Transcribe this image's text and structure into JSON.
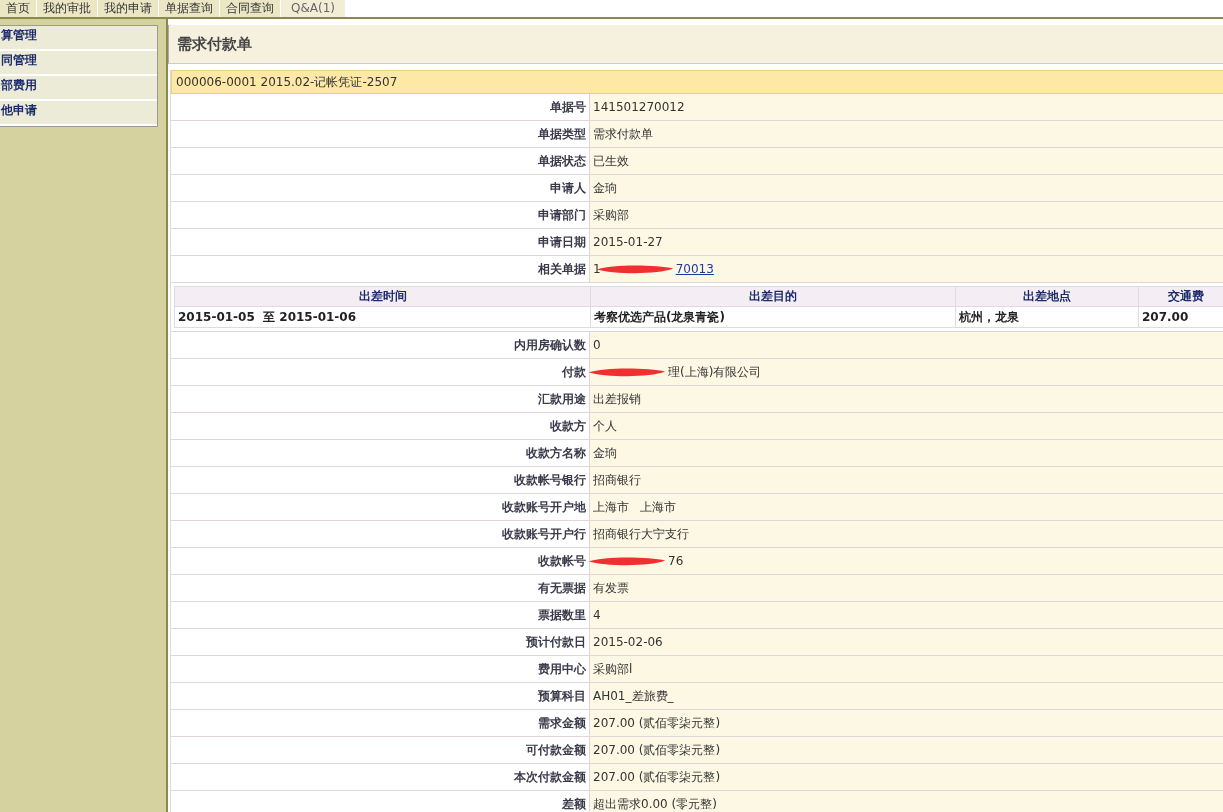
{
  "top_nav": [
    {
      "label": "首页",
      "selected": false
    },
    {
      "label": "我的审批",
      "selected": false
    },
    {
      "label": "我的申请",
      "selected": false
    },
    {
      "label": "单据查询",
      "selected": false
    },
    {
      "label": "合同查询",
      "selected": false
    },
    {
      "label": "Q&A(1)",
      "selected": true
    }
  ],
  "sidebar": {
    "items": [
      {
        "label": "算管理"
      },
      {
        "label": "同管理"
      },
      {
        "label": "部费用"
      },
      {
        "label": "他申请"
      }
    ]
  },
  "page_title": "需求付款单",
  "voucher": "000006-0001 2015.02-记帐凭证-2507",
  "fields_top": [
    {
      "label": "单据号",
      "value": "141501270012",
      "kind": "text"
    },
    {
      "label": "单据类型",
      "value": "需求付款单",
      "kind": "text"
    },
    {
      "label": "单据状态",
      "value": "已生效",
      "kind": "text"
    },
    {
      "label": "申请人",
      "value": "金珦",
      "kind": "text"
    },
    {
      "label": "申请部门",
      "value": "采购部",
      "kind": "text"
    },
    {
      "label": "申请日期",
      "value": "2015-01-27",
      "kind": "text"
    },
    {
      "label": "相关单据",
      "value_head": "1",
      "value": "70013",
      "kind": "link",
      "redacted": true
    }
  ],
  "trip_table": {
    "columns": [
      "出差时间",
      "出差目的",
      "出差地点",
      "交通费"
    ],
    "rows": [
      [
        "2015-01-05  至 2015-01-06",
        "考察优选产品(龙泉青瓷)",
        "杭州，龙泉",
        "207.00"
      ]
    ]
  },
  "fields_bottom": [
    {
      "label": "内用房确认数",
      "value": "0",
      "kind": "text"
    },
    {
      "label": "付款",
      "value": "理(上海)有限公司",
      "kind": "text",
      "redacted": true
    },
    {
      "label": "汇款用途",
      "value": "出差报销",
      "kind": "text"
    },
    {
      "label": "收款方",
      "value": "个人",
      "kind": "text"
    },
    {
      "label": "收款方名称",
      "value": "金珦",
      "kind": "text"
    },
    {
      "label": "收款帐号银行",
      "value": "招商银行",
      "kind": "text"
    },
    {
      "label": "收款账号开户地",
      "value": "上海市   上海市",
      "kind": "text"
    },
    {
      "label": "收款账号开户行",
      "value": "招商银行大宁支行",
      "kind": "text"
    },
    {
      "label": "收款帐号",
      "value": "76",
      "kind": "text",
      "redacted": true
    },
    {
      "label": "有无票据",
      "value": "有发票",
      "kind": "text"
    },
    {
      "label": "票据数里",
      "value": "4",
      "kind": "text"
    },
    {
      "label": "预计付款日",
      "value": "2015-02-06",
      "kind": "text"
    },
    {
      "label": "费用中心",
      "value": "采购部l",
      "kind": "text"
    },
    {
      "label": "预算科目",
      "value": "AH01_差旅费_",
      "kind": "text"
    },
    {
      "label": "需求金额",
      "value": "207.00 (贰佰零柒元整)",
      "kind": "text"
    },
    {
      "label": "可付款金额",
      "value": "207.00 (贰佰零柒元整)",
      "kind": "text"
    },
    {
      "label": "本次付款金额",
      "value": "207.00 (贰佰零柒元整)",
      "kind": "text"
    },
    {
      "label": "差额",
      "value": "超出需求0.00 (零元整)",
      "kind": "text"
    }
  ]
}
